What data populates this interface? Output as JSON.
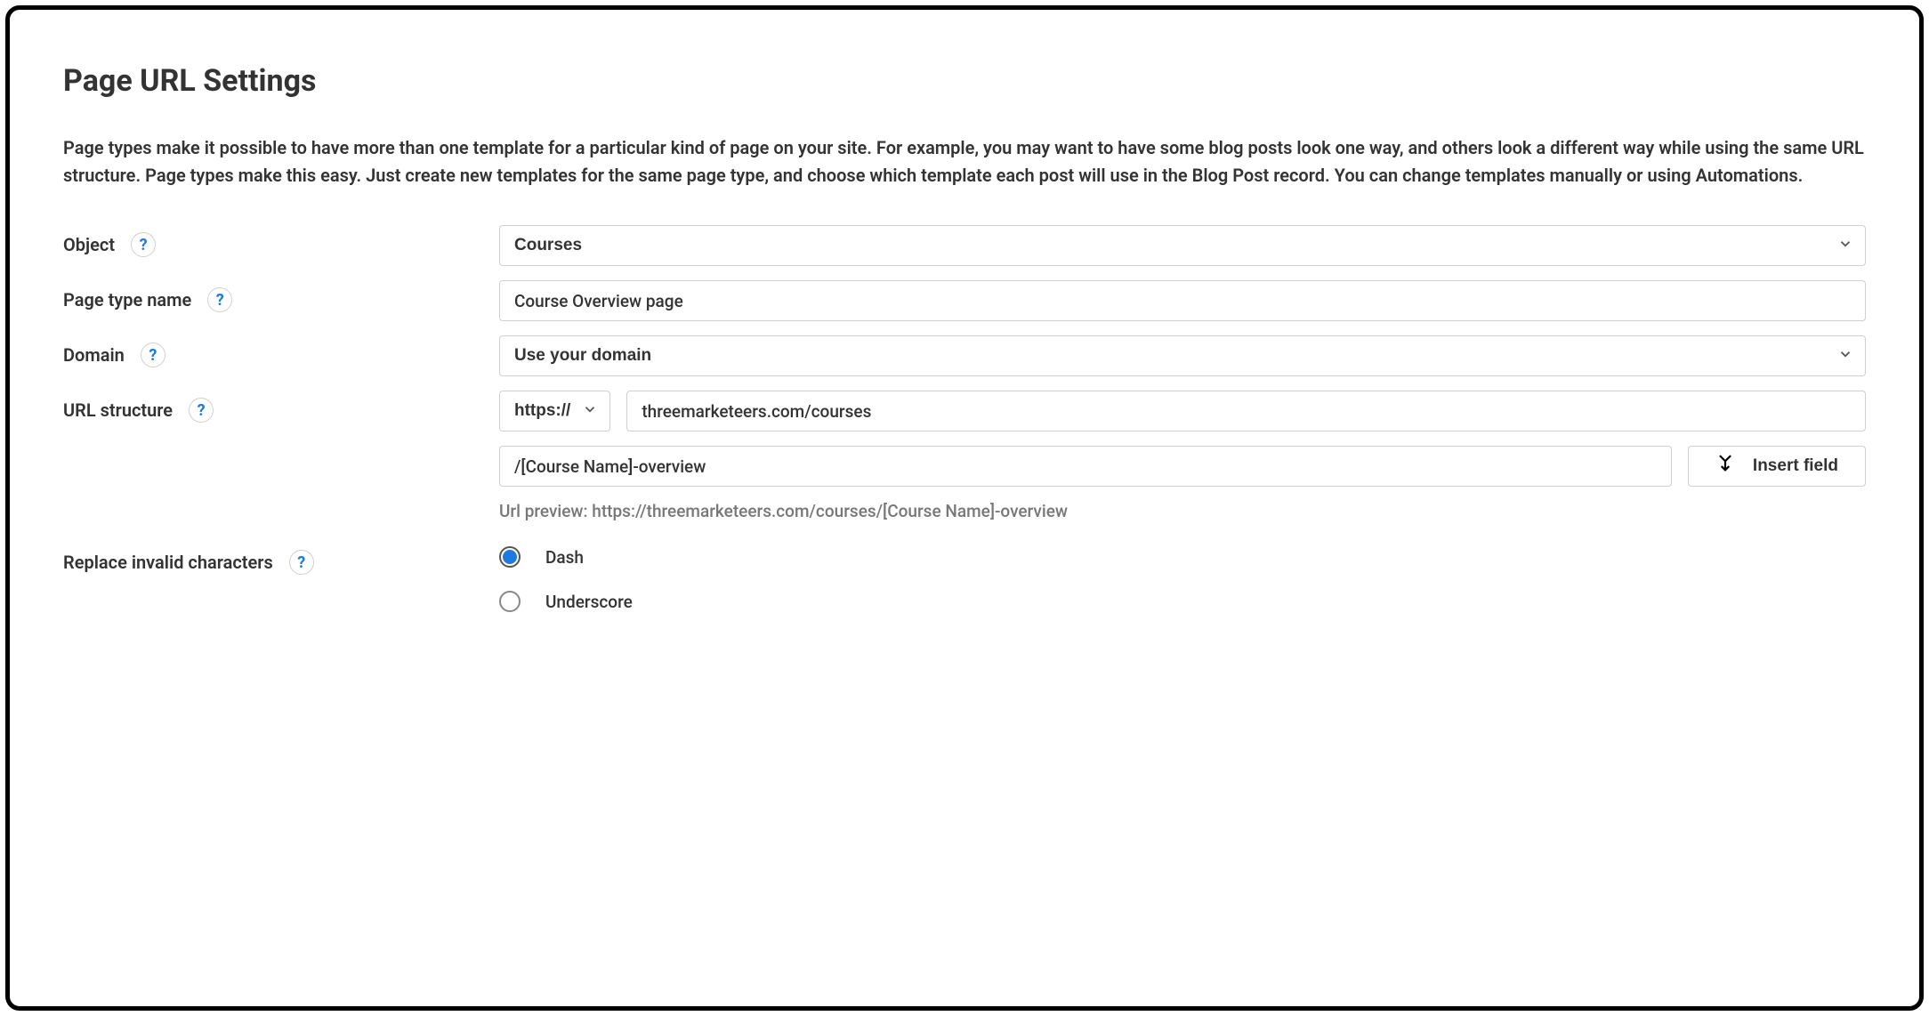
{
  "title": "Page URL Settings",
  "description": "Page types make it possible to have more than one template for a particular kind of page on your site. For example, you may want to have some blog posts look one way, and others look a different way while using the same URL structure. Page types make this easy. Just create new templates for the same page type, and choose which template each post will use in the Blog Post record. You can change templates manually or using Automations.",
  "help_glyph": "?",
  "fields": {
    "object": {
      "label": "Object",
      "value": "Courses"
    },
    "page_type_name": {
      "label": "Page type name",
      "value": "Course Overview page"
    },
    "domain": {
      "label": "Domain",
      "value": "Use your domain"
    },
    "url_structure": {
      "label": "URL structure",
      "protocol": "https://",
      "base": "threemarketeers.com/courses",
      "pattern": "/[Course Name]-overview",
      "insert_field_label": "Insert field",
      "preview_label": "Url preview: ",
      "preview_value": "https://threemarketeers.com/courses/[Course Name]-overview"
    },
    "replace_invalid": {
      "label": "Replace invalid characters",
      "options": {
        "dash": "Dash",
        "underscore": "Underscore"
      },
      "selected": "dash"
    }
  }
}
